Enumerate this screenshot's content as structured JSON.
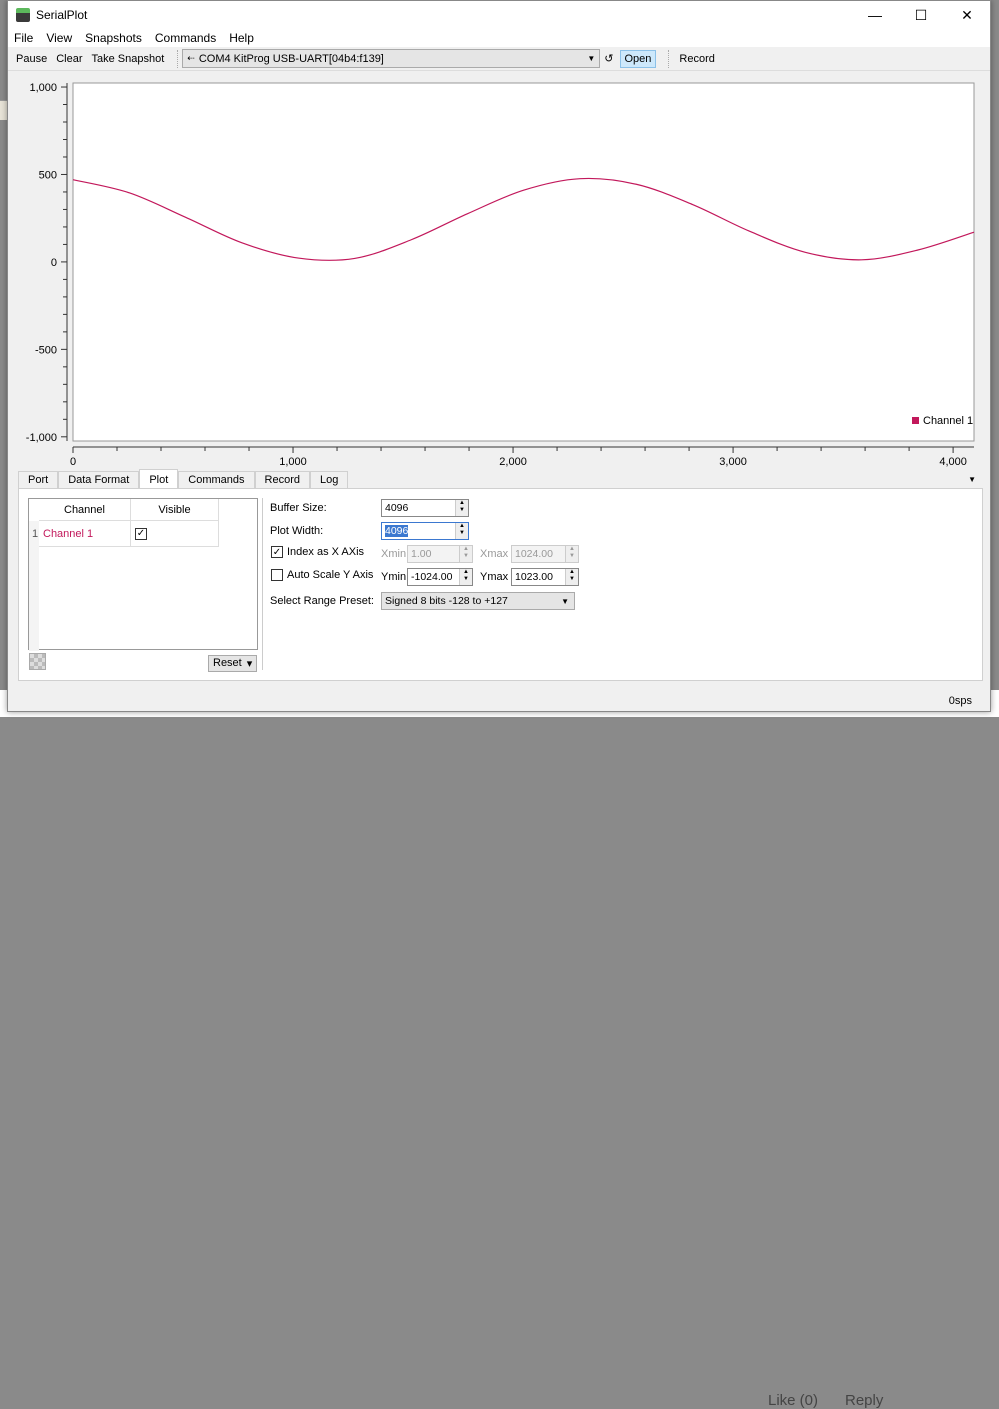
{
  "background": {
    "like": "Like (0)",
    "reply": "Reply"
  },
  "window": {
    "title": "SerialPlot",
    "minimize": "—",
    "maximize": "☐",
    "close": "✕"
  },
  "menu": [
    "File",
    "View",
    "Snapshots",
    "Commands",
    "Help"
  ],
  "toolbar": {
    "pause": "Pause",
    "clear": "Clear",
    "snapshot": "Take Snapshot",
    "port": "COM4 KitProg USB-UART[04b4:f139]",
    "refresh": "↺",
    "open": "Open",
    "record": "Record"
  },
  "chart_data": {
    "type": "line",
    "xlim": [
      0,
      4095
    ],
    "ylim": [
      -1024,
      1023
    ],
    "x_ticks": [
      "0",
      "1,000",
      "2,000",
      "3,000",
      "4,000"
    ],
    "y_ticks": [
      "1,000",
      "500",
      "0",
      "-500",
      "-1,000"
    ],
    "legend": "bottom-right",
    "series": [
      {
        "name": "Channel 1",
        "color": "#c2185b",
        "x": [
          0,
          256,
          512,
          768,
          1024,
          1280,
          1536,
          1792,
          2048,
          2304,
          2560,
          2816,
          3072,
          3328,
          3584,
          3840,
          4095
        ],
        "y": [
          470,
          395,
          255,
          109,
          22,
          20,
          126,
          275,
          410,
          476,
          444,
          328,
          177,
          55,
          12,
          68,
          170
        ]
      }
    ]
  },
  "tabs": [
    "Port",
    "Data Format",
    "Plot",
    "Commands",
    "Record",
    "Log"
  ],
  "active_tab": "Plot",
  "channels": {
    "header_channel": "Channel",
    "header_visible": "Visible",
    "rows": [
      {
        "index": "1",
        "name": "Channel 1",
        "visible": true,
        "check": "✓"
      }
    ],
    "reset": "Reset",
    "reset_arrow": "▾"
  },
  "plot_settings": {
    "buffer_size_label": "Buffer Size:",
    "buffer_size": "4096",
    "plot_width_label": "Plot Width:",
    "plot_width": "4096",
    "index_x_label": "Index as X AXis",
    "index_x_checked": true,
    "check": "✓",
    "xmin_label": "Xmin",
    "xmin": "1.00",
    "xmax_label": "Xmax",
    "xmax": "1024.00",
    "autoscale_label": "Auto Scale Y Axis",
    "autoscale_checked": false,
    "ymin_label": "Ymin",
    "ymin": "-1024.00",
    "ymax_label": "Ymax",
    "ymax": "1023.00",
    "preset_label": "Select Range Preset:",
    "preset": "Signed 8 bits -128 to +127"
  },
  "status": {
    "rate": "0sps"
  }
}
